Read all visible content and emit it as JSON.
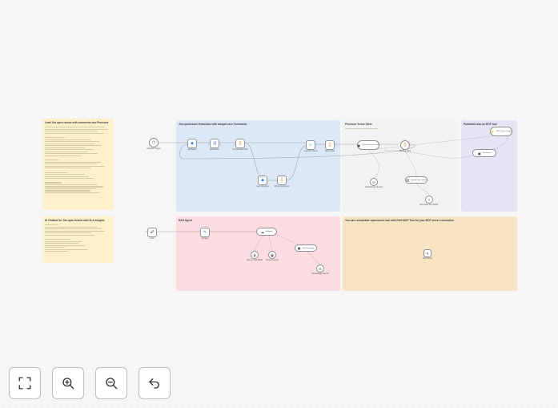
{
  "notes": {
    "load_jira": {
      "title": "Load Jira open issues with comments into Pinecone",
      "color": "#fdf1cc"
    },
    "extraction": {
      "title": "Jira openIssues Extraction with merged user Comments",
      "color": "#dde8f7"
    },
    "pinecone_store": {
      "title": "Pinecone Vector Store",
      "color": "#f2f2f3"
    },
    "mcp": {
      "title": "Published also as MCP tool",
      "color": "#e6e3f5"
    },
    "chatbot": {
      "title": "AI Chatbot for Jira open tickets with SLA insights",
      "color": "#fdf1cc"
    },
    "rag": {
      "title": "RAG Agent",
      "color": "#fbdde1"
    },
    "consolidate": {
      "title": "You can consolidate opensaurce tool with RAG MCP Tool for your MCP server connection",
      "color": "#f7e4c3"
    }
  },
  "nodes": {
    "schedule_trigger": {
      "label": "Schedule Trigger",
      "icon": "clock-icon"
    },
    "jira_search": {
      "label": "Jira Search",
      "icon": "jira-icon"
    },
    "split_issues": {
      "label": "Split Issues",
      "icon": "split-icon"
    },
    "format_issue": {
      "label": "Format Issue Data",
      "icon": "code-icon"
    },
    "loop_items": {
      "label": "Loop Over Items",
      "icon": "loop-icon"
    },
    "get_comments": {
      "label": "Get Comments",
      "icon": "jira-icon"
    },
    "merge_comments": {
      "label": "Merge Comments",
      "icon": "code-icon"
    },
    "merge_data": {
      "label": "Merge Data",
      "icon": "merge-icon"
    },
    "prepare_docs": {
      "label": "Prepare Docs",
      "icon": "code-icon"
    },
    "pinecone_insert": {
      "label": "Pinecone Vector Store",
      "icon": "pinecone-icon"
    },
    "default_loader": {
      "label": "Default Data Loader",
      "icon": "loader-icon"
    },
    "embeddings": {
      "label": "Embeddings OpenAI",
      "icon": "embed-icon"
    },
    "text_splitter": {
      "label": "Recursive Text Splitter",
      "icon": "split-icon"
    },
    "embeddings2": {
      "label": "Embeddings OpenAI",
      "icon": "embed-icon"
    },
    "mcp_trigger": {
      "label": "MCP Server Trigger",
      "icon": "mcp-icon"
    },
    "mcp_tool": {
      "label": "Jira Issues",
      "icon": "tool-icon"
    },
    "chat_trigger": {
      "label": "Chat",
      "icon": "chat-icon"
    },
    "ai_agent": {
      "label": "AI Agent",
      "icon": "agent-icon"
    },
    "chat_model": {
      "label": "OpenAI Chat Model",
      "icon": "openai-icon"
    },
    "memory": {
      "label": "Simple Memory",
      "icon": "memory-icon"
    },
    "rag_tool": {
      "label": "Jira Knowledge",
      "icon": "tool-icon"
    },
    "embeddings3": {
      "label": "Embeddings OpenAI",
      "icon": "embed-icon"
    },
    "mcp_client": {
      "label": "MCP Client",
      "icon": "mcp-icon"
    }
  },
  "controls": {
    "fit_view": {
      "icon": "fit-view-icon"
    },
    "zoom_in": {
      "icon": "zoom-in-icon"
    },
    "zoom_out": {
      "icon": "zoom-out-icon"
    },
    "undo": {
      "icon": "undo-icon"
    }
  }
}
